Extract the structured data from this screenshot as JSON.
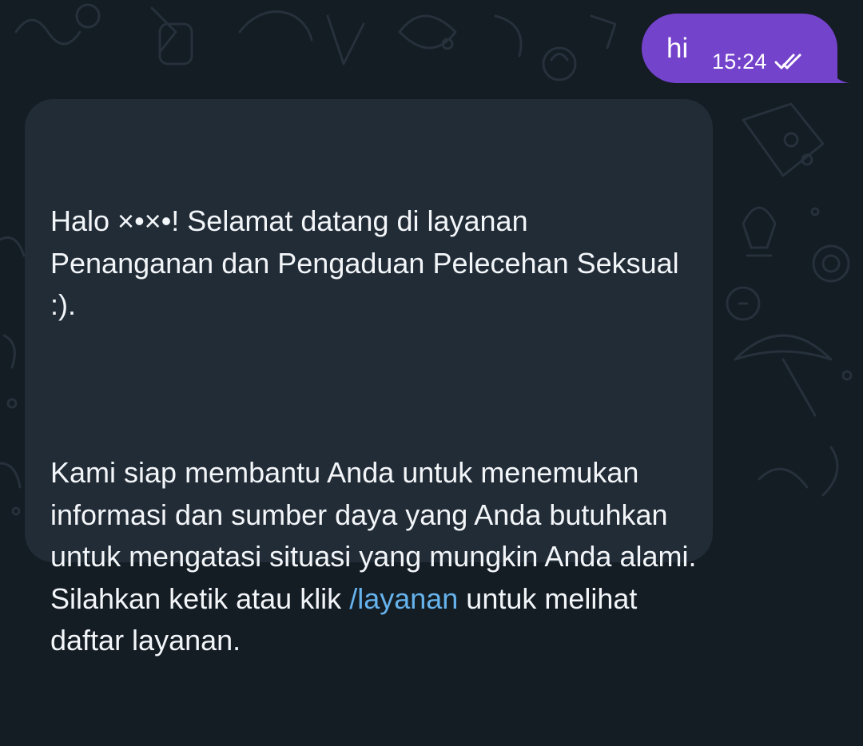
{
  "messages": {
    "outgoing": {
      "text": "hi",
      "time": "15:24",
      "status_icon": "double-check-icon"
    },
    "incoming": {
      "para1": "Halo ×•×•! Selamat datang di layanan Penanganan dan Pengaduan Pelecehan Seksual :).",
      "para2_before": "Kami siap membantu Anda untuk menemukan informasi dan sumber daya yang Anda butuhkan untuk mengatasi situasi yang mungkin Anda alami. Silahkan ketik atau klik ",
      "command": "/layanan",
      "para2_after": " untuk melihat daftar layanan."
    }
  },
  "colors": {
    "background": "#141c24",
    "outgoing_bubble": "#7443cc",
    "incoming_bubble": "#222c37",
    "link": "#66b3ec",
    "text": "#f3f6f9"
  }
}
